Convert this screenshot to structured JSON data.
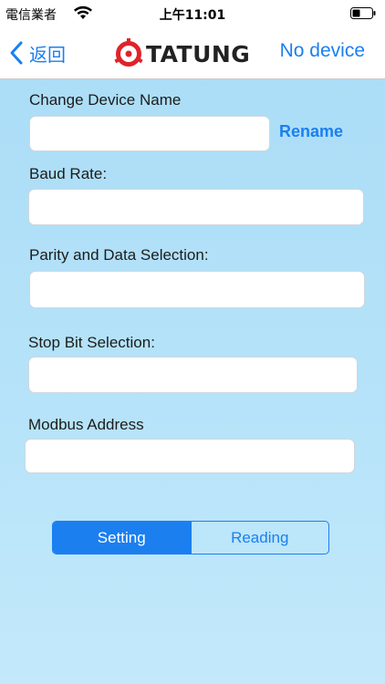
{
  "status_bar": {
    "carrier": "電信業者",
    "time": "上午11:01",
    "icons": [
      "wifi-icon",
      "battery-icon"
    ]
  },
  "nav": {
    "back_label": "返回",
    "logo_text": "TATUNG",
    "device_status": "No device"
  },
  "form": {
    "device_name": {
      "label": "Change Device Name",
      "value": ""
    },
    "rename_label": "Rename",
    "baud_rate": {
      "label": "Baud Rate:",
      "value": ""
    },
    "parity": {
      "label": "Parity and Data Selection:",
      "value": ""
    },
    "stop_bit": {
      "label": "Stop Bit Selection:",
      "value": ""
    },
    "modbus_address": {
      "label": "Modbus Address",
      "value": ""
    }
  },
  "segmented": {
    "options": [
      "Setting",
      "Reading"
    ],
    "selected": "Setting"
  },
  "colors": {
    "accent": "#1b7ff0",
    "background": "#b3e2f8",
    "logo_red": "#e0232b"
  }
}
